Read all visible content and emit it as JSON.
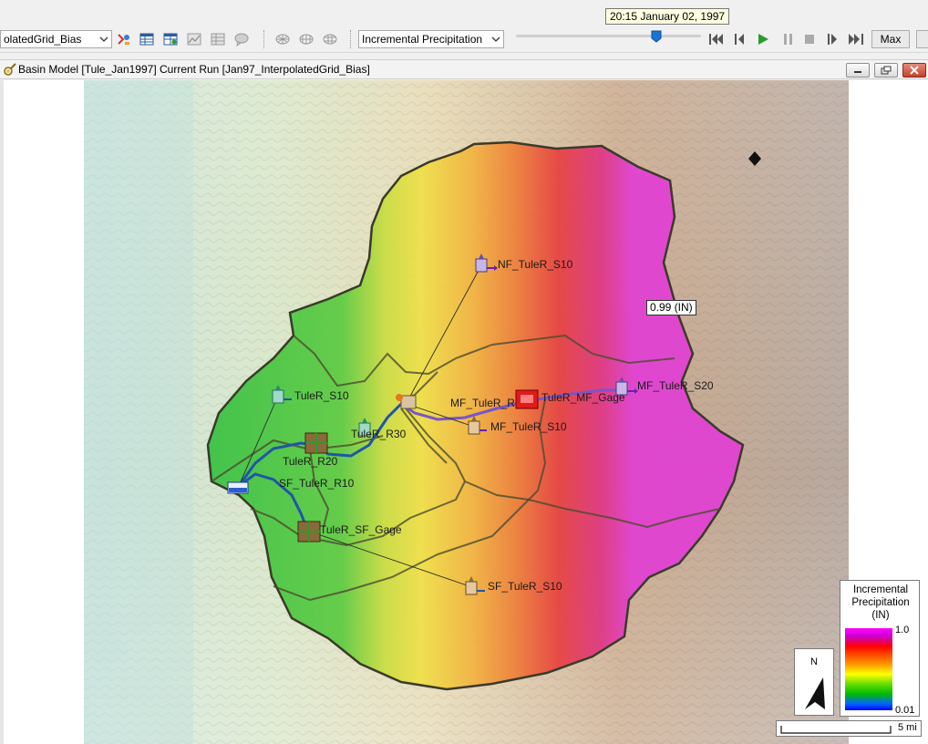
{
  "toolbar": {
    "run_combo_value": "olatedGrid_Bias",
    "parameter_combo_value": "Incremental Precipitation",
    "max_button_label": "Max",
    "time_tooltip": "20:15 January 02, 1997"
  },
  "window": {
    "title": "Basin Model [Tule_Jan1997] Current Run [Jan97_InterpolatedGrid_Bias]"
  },
  "map": {
    "value_readout": "0.99 (IN)",
    "elements": {
      "nf_subbasin": "NF_TuleR_S10",
      "mf_subbasin_s20": "MF_TuleR_S20",
      "mf_gage": "TuleR_MF_Gage",
      "mf_reach": "MF_TuleR_R",
      "mf_subbasin_s10": "MF_TuleR_S10",
      "s10": "TuleR_S10",
      "r30": "TuleR_R30",
      "r20": "TuleR_R20",
      "sf_reach": "SF_TuleR_R10",
      "sf_gage": "TuleR_SF_Gage",
      "sf_subbasin": "SF_TuleR_S10"
    }
  },
  "legend": {
    "title_line1": "Incremental",
    "title_line2": "Precipitation",
    "title_line3": "(IN)",
    "max_value": "1.0",
    "min_value": "0.01",
    "colors": [
      "#ff00ff",
      "#ff0000",
      "#ff9900",
      "#ffff00",
      "#00bb00",
      "#0000ff"
    ]
  },
  "north_arrow": {
    "label": "N"
  },
  "scale_bar": {
    "label": "5 mi"
  }
}
